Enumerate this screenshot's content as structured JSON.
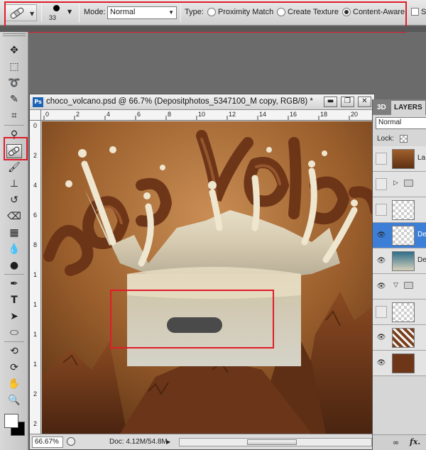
{
  "options_bar": {
    "brush_size": "33",
    "mode_label": "Mode:",
    "mode_value": "Normal",
    "type_label": "Type:",
    "type_options": [
      {
        "label": "Proximity Match",
        "selected": false
      },
      {
        "label": "Create Texture",
        "selected": false
      },
      {
        "label": "Content-Aware",
        "selected": true
      }
    ],
    "sample_all_label": "S"
  },
  "document": {
    "title": "choco_volcano.psd @ 66.7% (Depositphotos_5347100_M copy, RGB/8) *",
    "app_badge": "Ps",
    "ruler_h_labels": [
      "0",
      "2",
      "4",
      "6",
      "8",
      "10",
      "12",
      "14",
      "16",
      "18",
      "20"
    ],
    "ruler_v_labels": [
      "0",
      "2",
      "4",
      "6",
      "8",
      "1",
      "1",
      "1",
      "1",
      "2",
      "2"
    ],
    "zoom": "66.67%",
    "doc_size": "Doc: 4.12M/54.8M"
  },
  "layers_panel": {
    "tab_3d": "3D",
    "tab_layers": "LAYERS",
    "blend_mode": "Normal",
    "lock_label": "Lock:",
    "layers": [
      {
        "name": "La",
        "visible": false,
        "selected": false
      },
      {
        "name": "",
        "visible": false,
        "selected": false,
        "group": true
      },
      {
        "name": "",
        "visible": false,
        "selected": false
      },
      {
        "name": "Dep",
        "visible": true,
        "selected": true
      },
      {
        "name": "Dep",
        "visible": true,
        "selected": false
      },
      {
        "name": "",
        "visible": true,
        "selected": false,
        "group": true
      },
      {
        "name": "",
        "visible": false,
        "selected": false
      },
      {
        "name": "",
        "visible": true,
        "selected": false
      },
      {
        "name": "",
        "visible": true,
        "selected": false
      }
    ],
    "footer_fx": "fx."
  },
  "colors": {
    "foreground": "#ffffff",
    "background": "#000000",
    "highlight": "#e11b2a",
    "selection": "#3d7fd6"
  }
}
